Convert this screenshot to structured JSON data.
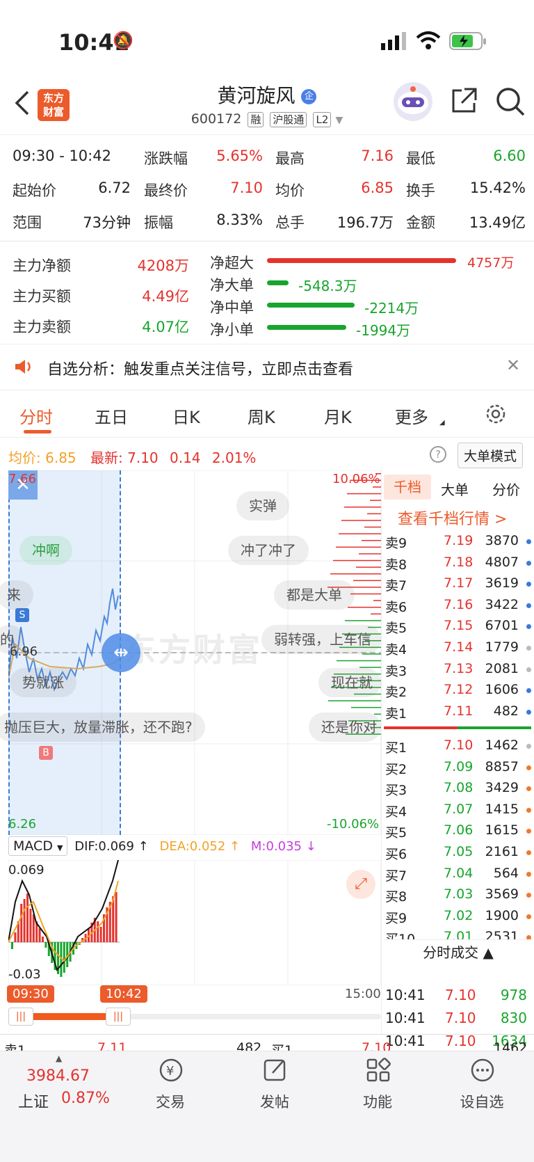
{
  "status": {
    "time": "10:41"
  },
  "header": {
    "name": "黄河旋风",
    "code": "600172",
    "tags": [
      "融",
      "沪股通",
      "L2"
    ],
    "logo_line1": "东方",
    "logo_line2": "财富",
    "badge": "企"
  },
  "quote": {
    "period": "09:30 - 10:42",
    "row1": [
      {
        "l": "涨跌幅",
        "v": "5.65%"
      },
      {
        "l": "最高",
        "v": "7.16"
      },
      {
        "l": "最低",
        "v": "6.60"
      }
    ],
    "row2": [
      {
        "l": "起始价",
        "v": "6.72"
      },
      {
        "l": "最终价",
        "v": "7.10"
      },
      {
        "l": "均价",
        "v": "6.85"
      },
      {
        "l": "换手",
        "v": "15.42%"
      }
    ],
    "row3": [
      {
        "l": "范围",
        "v": "73分钟"
      },
      {
        "l": "振幅",
        "v": "8.33%"
      },
      {
        "l": "总手",
        "v": "196.7万"
      },
      {
        "l": "金额",
        "v": "13.49亿"
      }
    ]
  },
  "fund": {
    "left": [
      {
        "l": "主力净额",
        "v": "4208万"
      },
      {
        "l": "主力买额",
        "v": "4.49亿"
      },
      {
        "l": "主力卖额",
        "v": "4.07亿"
      }
    ],
    "right": [
      {
        "l": "净超大",
        "v": "4757万",
        "ratio": 1.0
      },
      {
        "l": "净大单",
        "v": "-548.3万",
        "ratio": 0.115
      },
      {
        "l": "净中单",
        "v": "-2214万",
        "ratio": 0.465
      },
      {
        "l": "净小单",
        "v": "-1994万",
        "ratio": 0.42
      }
    ]
  },
  "notice": {
    "text": "自选分析：触发重点关注信号，立即点击查看"
  },
  "tabs": [
    "分时",
    "五日",
    "日K",
    "周K",
    "月K",
    "更多"
  ],
  "price_line": {
    "avg_label": "均价:",
    "avg": "6.85",
    "last_label": "最新:",
    "last": "7.10",
    "chg": "0.14",
    "pct": "2.01%",
    "mode_btn": "大单模式"
  },
  "chart": {
    "top_price": "7.66",
    "bottom_price": "6.26",
    "top_pct": "10.06%",
    "bottom_pct": "-10.06%",
    "mid_label": "6.96",
    "start": "09:30",
    "end": "10:42",
    "close_time": "15:00",
    "watermark": "东方财富"
  },
  "bubbles": [
    "实弹",
    "冲啊",
    "冲了冲了",
    "来",
    "都是大单",
    "弱转强，上车信",
    "势就涨",
    "现在就",
    "抛压巨大，放量滞胀，还不跑?",
    "还是你对",
    "的"
  ],
  "macd": {
    "name": "MACD",
    "dif": "DIF:0.069 ↑",
    "dea": "DEA:0.052 ↑",
    "m": "M:0.035 ↓",
    "top": "0.069",
    "bottom": "-0.03"
  },
  "orderbook": {
    "tabs": [
      "千档",
      "大单",
      "分价"
    ],
    "link": "查看千档行情 >",
    "sells": [
      [
        "卖9",
        "7.19",
        "3870"
      ],
      [
        "卖8",
        "7.18",
        "4807"
      ],
      [
        "卖7",
        "7.17",
        "3619"
      ],
      [
        "卖6",
        "7.16",
        "3422"
      ],
      [
        "卖5",
        "7.15",
        "6701"
      ],
      [
        "卖4",
        "7.14",
        "1779"
      ],
      [
        "卖3",
        "7.13",
        "2081"
      ],
      [
        "卖2",
        "7.12",
        "1606"
      ],
      [
        "卖1",
        "7.11",
        "482"
      ]
    ],
    "buys": [
      [
        "买1",
        "7.10",
        "1462"
      ],
      [
        "买2",
        "7.09",
        "8857"
      ],
      [
        "买3",
        "7.08",
        "3429"
      ],
      [
        "买4",
        "7.07",
        "1415"
      ],
      [
        "买5",
        "7.06",
        "1615"
      ],
      [
        "买6",
        "7.05",
        "2161"
      ],
      [
        "买7",
        "7.04",
        "564"
      ],
      [
        "买8",
        "7.03",
        "3569"
      ],
      [
        "买9",
        "7.02",
        "1900"
      ],
      [
        "买10",
        "7.01",
        "2531"
      ]
    ],
    "trades_title": "分时成交 ▲",
    "trades": [
      [
        "10:41",
        "7.10",
        "978"
      ],
      [
        "10:41",
        "7.10",
        "830"
      ],
      [
        "10:41",
        "7.10",
        "1634"
      ]
    ]
  },
  "bottom_quote": {
    "s1": "卖1",
    "s1p": "7.11",
    "s1v": "482",
    "b1": "买1",
    "b1p": "7.10",
    "b1v": "1462"
  },
  "bottom_nav": {
    "index_value": "3984.67",
    "index_name": "上证",
    "index_pct": "0.87%",
    "items": [
      "交易",
      "发帖",
      "功能",
      "设自选"
    ]
  },
  "colors": {
    "red": "#e5322d",
    "green": "#18a52d",
    "orange": "#f2a227",
    "brand": "#ec5b2b"
  }
}
